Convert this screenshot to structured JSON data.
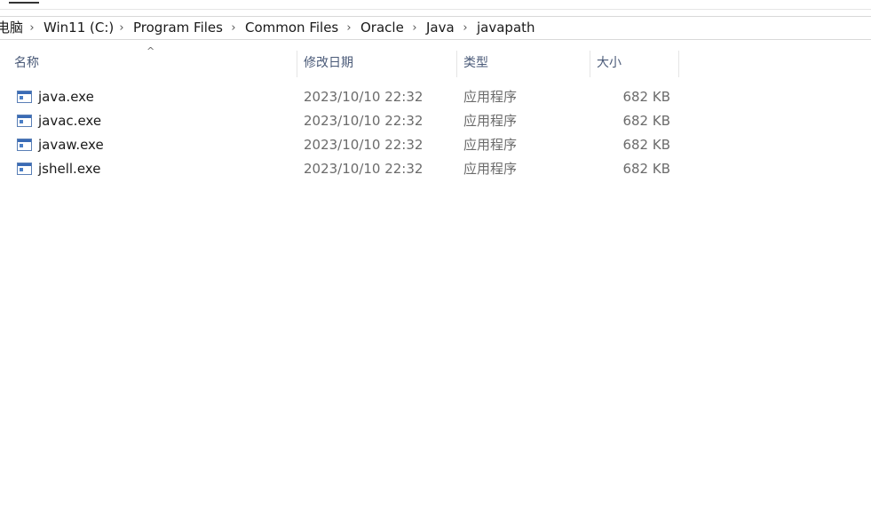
{
  "breadcrumb": {
    "items": [
      "电脑",
      "Win11 (C:)",
      "Program Files",
      "Common Files",
      "Oracle",
      "Java",
      "javapath"
    ],
    "separator": "›"
  },
  "columns": {
    "name": "名称",
    "modified": "修改日期",
    "type": "类型",
    "size": "大小",
    "sort_indicator": "^"
  },
  "files": [
    {
      "name": "java.exe",
      "modified": "2023/10/10 22:32",
      "type": "应用程序",
      "size": "682 KB"
    },
    {
      "name": "javac.exe",
      "modified": "2023/10/10 22:32",
      "type": "应用程序",
      "size": "682 KB"
    },
    {
      "name": "javaw.exe",
      "modified": "2023/10/10 22:32",
      "type": "应用程序",
      "size": "682 KB"
    },
    {
      "name": "jshell.exe",
      "modified": "2023/10/10 22:32",
      "type": "应用程序",
      "size": "682 KB"
    }
  ],
  "icons": {
    "file": "application-exe-icon",
    "separator": "chevron-right-icon"
  }
}
